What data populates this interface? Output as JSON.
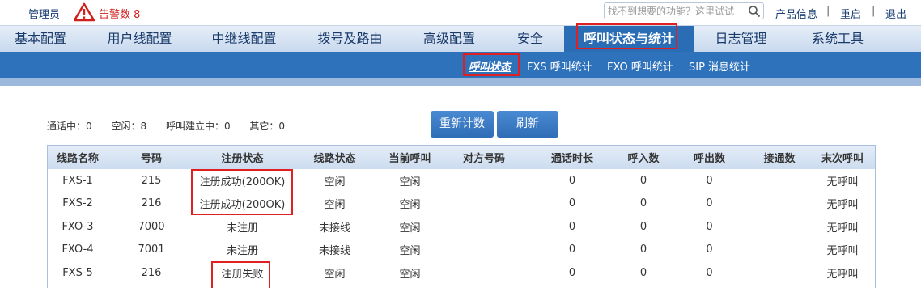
{
  "header": {
    "user": "管理员",
    "alarm_label": "告警数 8",
    "search_placeholder": "找不到想要的功能？这里试试",
    "links": [
      "产品信息",
      "重启",
      "退出"
    ]
  },
  "main_nav": [
    {
      "label": "基本配置"
    },
    {
      "label": "用户线配置"
    },
    {
      "label": "中继线配置"
    },
    {
      "label": "拨号及路由"
    },
    {
      "label": "高级配置"
    },
    {
      "label": "安全"
    },
    {
      "label": "呼叫状态与统计",
      "active": true
    },
    {
      "label": "日志管理"
    },
    {
      "label": "系统工具"
    }
  ],
  "sub_nav": [
    {
      "label": "呼叫状态",
      "active": true
    },
    {
      "label": "FXS 呼叫统计"
    },
    {
      "label": "FXO 呼叫统计"
    },
    {
      "label": "SIP 消息统计"
    }
  ],
  "summary": [
    "通话中：0",
    "空闲：8",
    "呼叫建立中：0",
    "其它：0"
  ],
  "buttons": {
    "recount": "重新计数",
    "refresh": "刷新"
  },
  "table": {
    "headers": [
      "线路名称",
      "号码",
      "注册状态",
      "线路状态",
      "当前呼叫",
      "对方号码",
      "通话时长",
      "呼入数",
      "呼出数",
      "接通数",
      "末次呼叫"
    ],
    "rows": [
      [
        "FXS-1",
        "215",
        "注册成功(200OK)",
        "空闲",
        "空闲",
        "",
        "0",
        "0",
        "0",
        "",
        "无呼叫"
      ],
      [
        "FXS-2",
        "216",
        "注册成功(200OK)",
        "空闲",
        "空闲",
        "",
        "0",
        "0",
        "0",
        "",
        "无呼叫"
      ],
      [
        "FXO-3",
        "7000",
        "未注册",
        "未接线",
        "空闲",
        "",
        "0",
        "0",
        "0",
        "",
        "无呼叫"
      ],
      [
        "FXO-4",
        "7001",
        "未注册",
        "未接线",
        "空闲",
        "",
        "0",
        "0",
        "0",
        "",
        "无呼叫"
      ],
      [
        "FXS-5",
        "216",
        "注册失败",
        "空闲",
        "空闲",
        "",
        "0",
        "0",
        "0",
        "",
        "无呼叫"
      ]
    ]
  },
  "colors": {
    "nav_active": "#2b6db5",
    "subnav": "#2f72bc",
    "highlight": "#e02020",
    "alarm": "#d0201c"
  }
}
